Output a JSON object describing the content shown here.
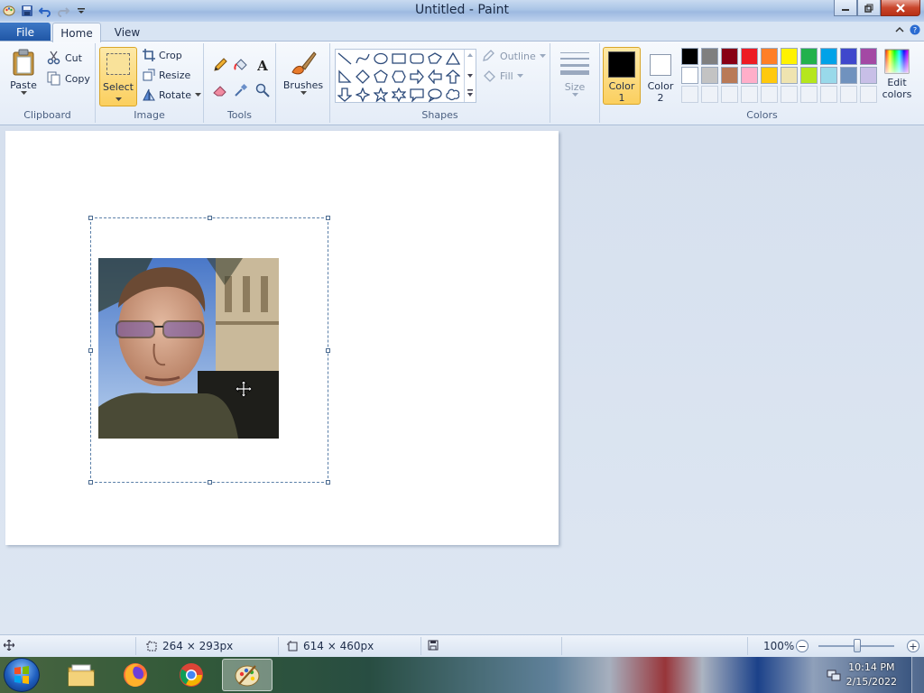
{
  "window": {
    "title": "Untitled - Paint"
  },
  "tabs": {
    "file": "File",
    "home": "Home",
    "view": "View"
  },
  "clipboard": {
    "label": "Clipboard",
    "paste": "Paste",
    "cut": "Cut",
    "copy": "Copy"
  },
  "image": {
    "label": "Image",
    "select": "Select",
    "crop": "Crop",
    "resize": "Resize",
    "rotate": "Rotate"
  },
  "tools": {
    "label": "Tools"
  },
  "brushes": {
    "label": "Brushes"
  },
  "shapes": {
    "label": "Shapes",
    "outline": "Outline",
    "fill": "Fill"
  },
  "size": {
    "label": "Size"
  },
  "colors": {
    "label": "Colors",
    "color1": {
      "line1": "Color",
      "line2": "1",
      "value": "#000000"
    },
    "color2": {
      "line1": "Color",
      "line2": "2",
      "value": "#ffffff"
    },
    "edit_line1": "Edit",
    "edit_line2": "colors",
    "palette_row1": [
      "#000000",
      "#7f7f7f",
      "#880015",
      "#ed1c24",
      "#ff7f27",
      "#fff200",
      "#22b14c",
      "#00a2e8",
      "#3f48cc",
      "#a349a4"
    ],
    "palette_row2": [
      "#ffffff",
      "#c3c3c3",
      "#b97a57",
      "#ffaec9",
      "#ffc90e",
      "#efe4b0",
      "#b5e61d",
      "#99d9ea",
      "#7092be",
      "#c8bfe7"
    ]
  },
  "status": {
    "selection_size": "264 × 293px",
    "canvas_size": "614 × 460px",
    "zoom": "100%"
  },
  "taskbar": {
    "time": "10:14 PM",
    "date": "2/15/2022"
  }
}
